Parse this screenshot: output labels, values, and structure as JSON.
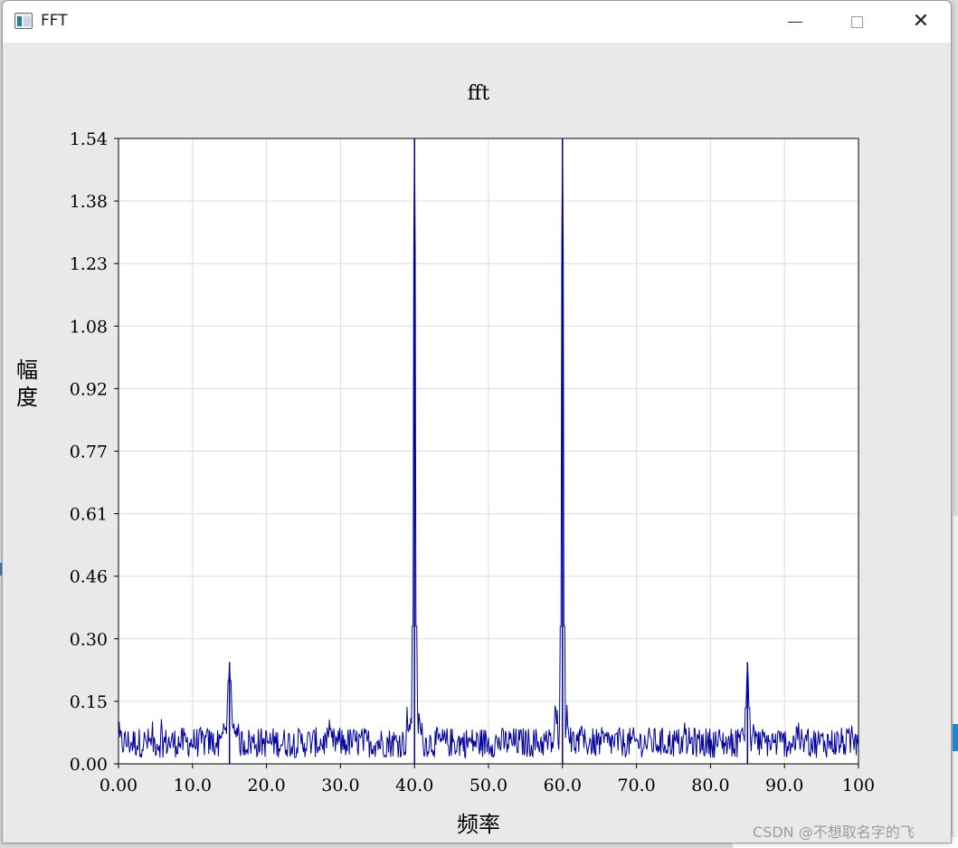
{
  "window": {
    "title": "FFT",
    "icons": {
      "app": "app-window-icon",
      "minimize": "minimize-icon",
      "maximize": "maximize-icon",
      "close": "close-icon"
    },
    "close_glyph": "✕"
  },
  "chart_data": {
    "type": "line",
    "title": "fft",
    "xlabel": "频率",
    "ylabel": "幅度",
    "xlim": [
      0,
      100
    ],
    "ylim": [
      0,
      1.54
    ],
    "x_ticks": [
      "0.00",
      "10.0",
      "20.0",
      "30.0",
      "40.0",
      "50.0",
      "60.0",
      "70.0",
      "80.0",
      "90.0",
      "100"
    ],
    "y_ticks": [
      "0.00",
      "0.15",
      "0.30",
      "0.46",
      "0.61",
      "0.77",
      "0.92",
      "1.08",
      "1.23",
      "1.38",
      "1.54"
    ],
    "grid": true,
    "legend": "none",
    "series": [
      {
        "color": "#0000a0",
        "noise_floor": 0.06,
        "peaks": [
          {
            "x": 15,
            "y": 0.25
          },
          {
            "x": 40,
            "y": 1.54
          },
          {
            "x": 60,
            "y": 1.54
          },
          {
            "x": 85,
            "y": 0.25
          }
        ]
      }
    ]
  },
  "watermark": "CSDN @不想取名字的飞"
}
